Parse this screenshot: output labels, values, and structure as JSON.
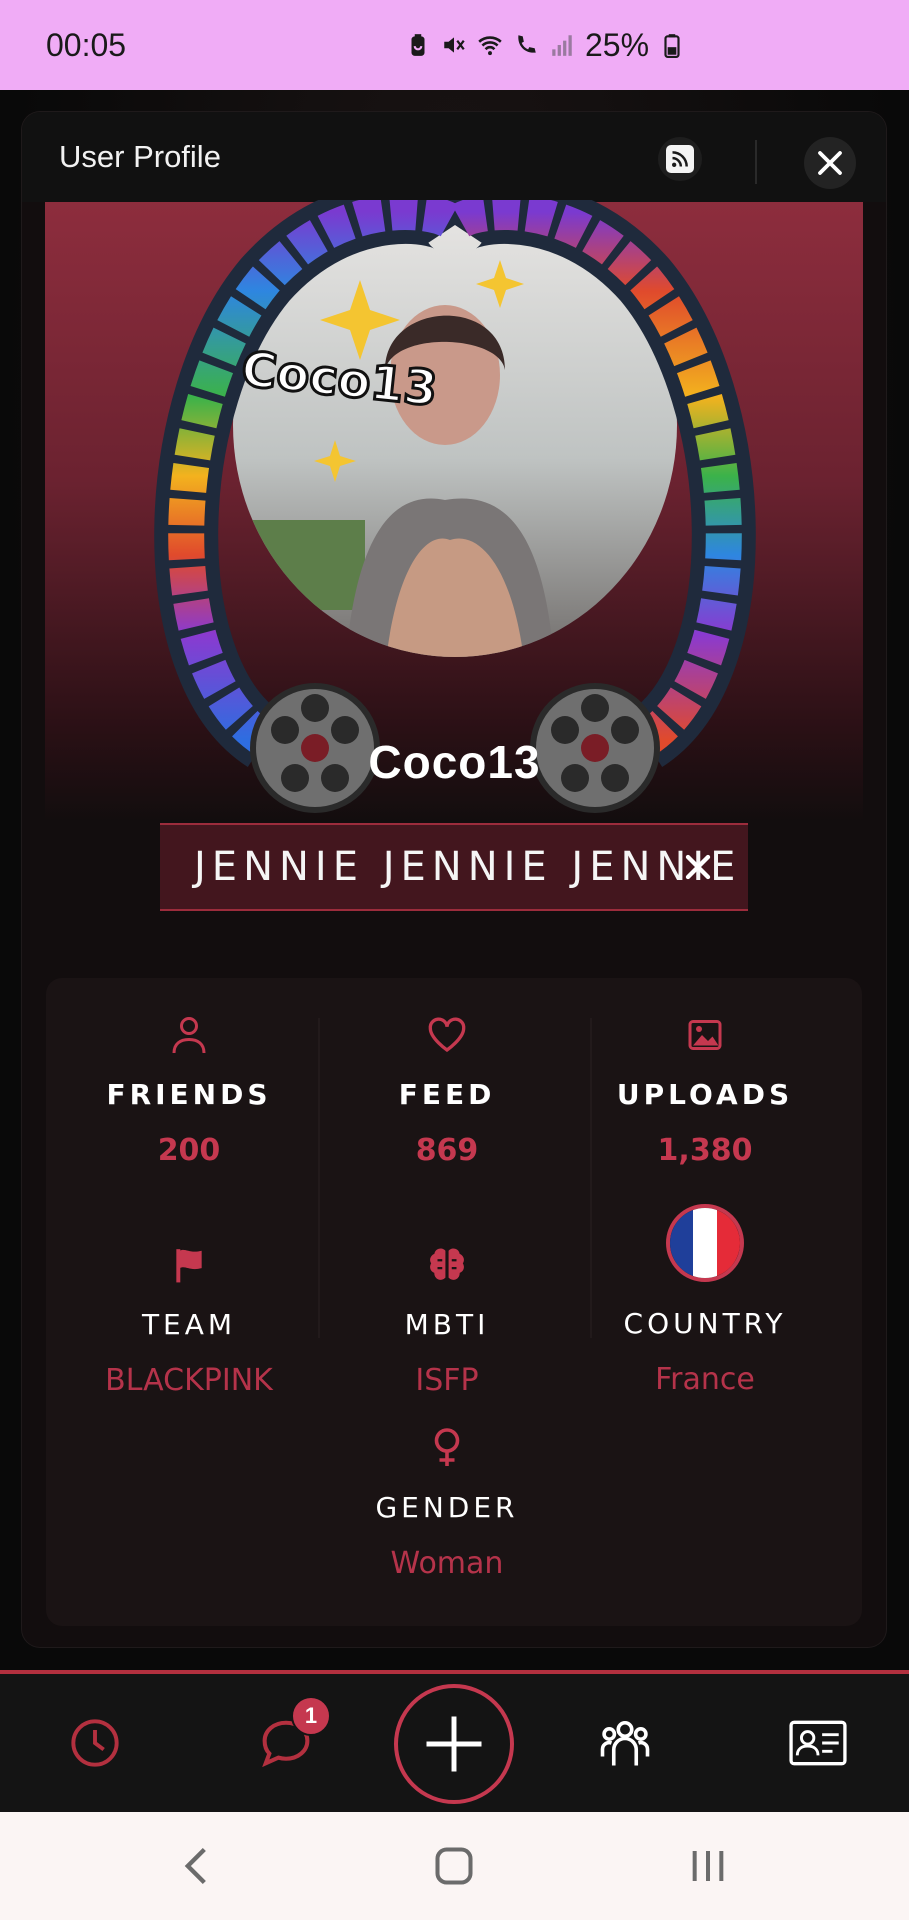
{
  "status_bar": {
    "time": "00:05",
    "battery_text": "25%",
    "icons": [
      "battery-saver-icon",
      "mute-icon",
      "wifi-icon",
      "wifi-calling-icon",
      "signal-icon",
      "battery-icon"
    ]
  },
  "modal": {
    "title": "User Profile",
    "rss_icon": "rss-icon",
    "close_icon": "close-icon"
  },
  "profile": {
    "username": "Coco13",
    "tag": "JENNIE JENNIE JENNIE"
  },
  "stats": [
    {
      "label": "FRIENDS",
      "value": "200",
      "icon": "user-icon"
    },
    {
      "label": "FEED",
      "value": "869",
      "icon": "heart-icon"
    },
    {
      "label": "UPLOADS",
      "value": "1,380",
      "icon": "image-icon"
    },
    {
      "label": "TEAM",
      "value": "BLACKPINK",
      "icon": "flag-icon"
    },
    {
      "label": "MBTI",
      "value": "ISFP",
      "icon": "brain-icon"
    },
    {
      "label": "COUNTRY",
      "value": "France",
      "icon": "france-flag-icon"
    },
    {
      "label": "GENDER",
      "value": "Woman",
      "icon": "female-icon"
    }
  ],
  "bottom_nav": {
    "items": [
      "history-icon",
      "chat-icon",
      "add-icon",
      "groups-icon",
      "profile-card-icon"
    ],
    "chat_badge": "1"
  },
  "colors": {
    "accent": "#c5384f",
    "status_bar": "#f0acf6",
    "hero_top": "#8d2d3d"
  }
}
